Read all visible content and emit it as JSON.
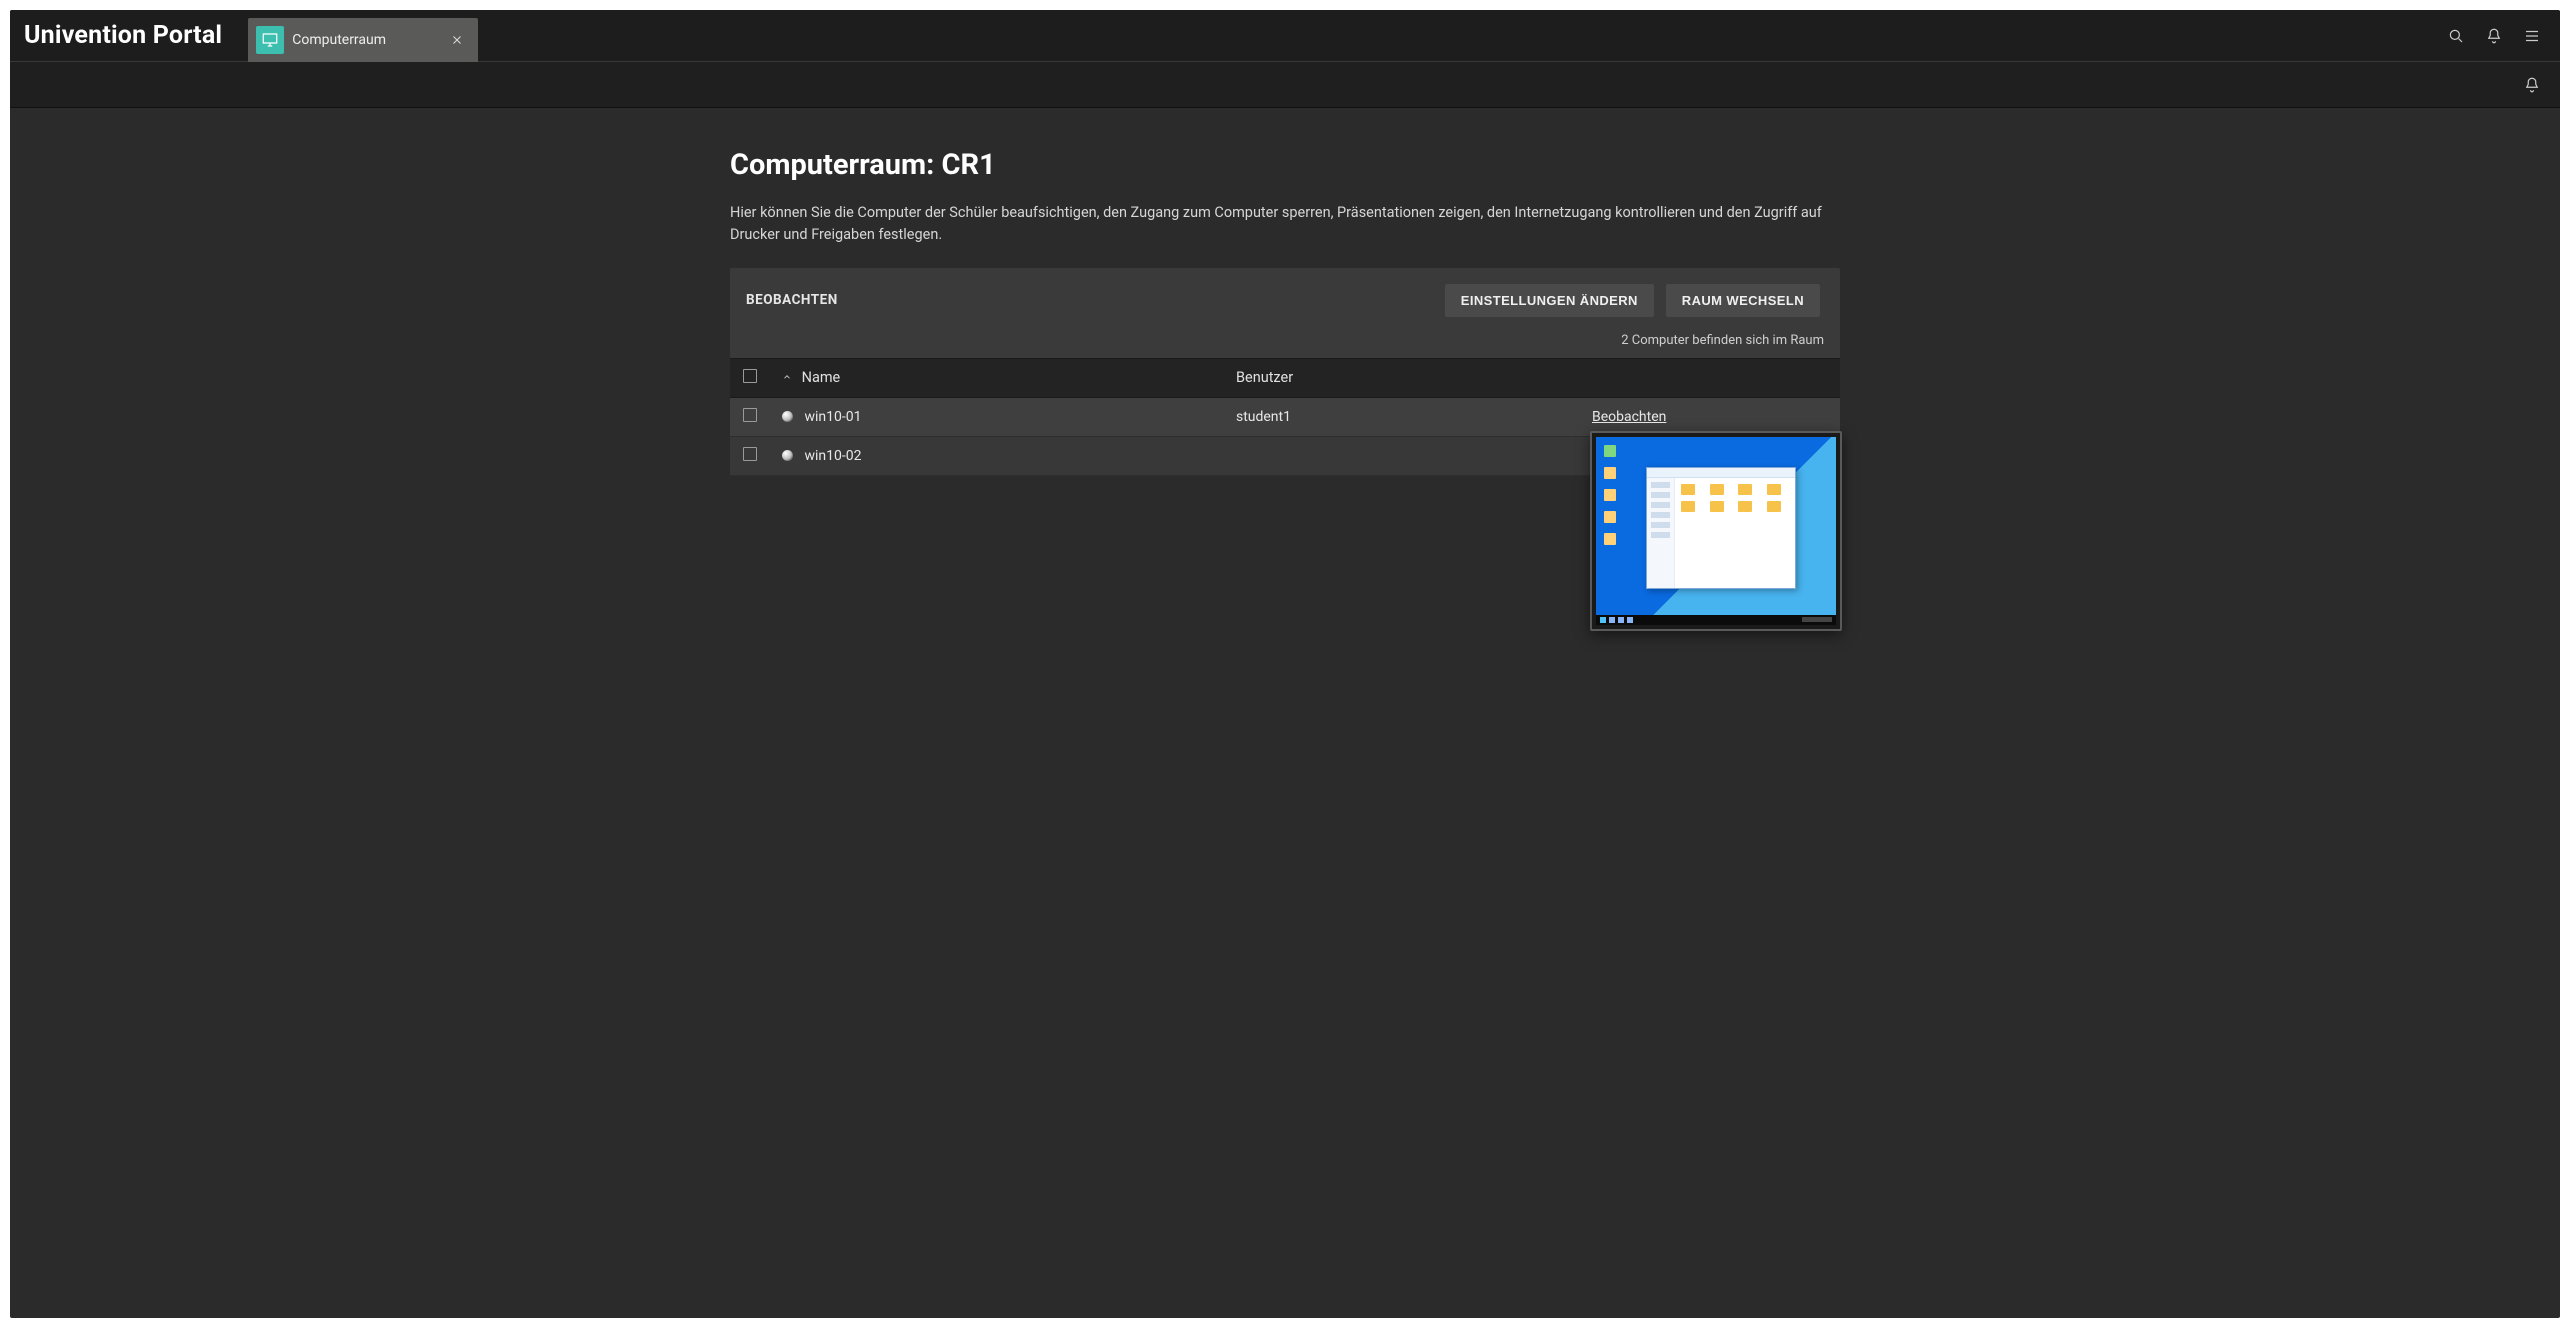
{
  "app": {
    "brand": "Univention Portal"
  },
  "tabs": [
    {
      "label": "Computerraum"
    }
  ],
  "page": {
    "title": "Computerraum: CR1",
    "description": "Hier können Sie die Computer der Schüler beaufsichtigen, den Zugang zum Computer sperren, Präsentationen zeigen, den Internetzugang kontrollieren und den Zugriff auf Drucker und Freigaben festlegen."
  },
  "panel": {
    "title": "BEOBACHTEN",
    "buttons": {
      "settings": "EINSTELLUNGEN ÄNDERN",
      "switch_room": "RAUM WECHSELN"
    },
    "subtext": "2 Computer befinden sich im Raum"
  },
  "table": {
    "columns": {
      "name": "Name",
      "user": "Benutzer"
    },
    "rows": [
      {
        "name": "win10-01",
        "user": "student1",
        "action": "Beobachten"
      },
      {
        "name": "win10-02",
        "user": "",
        "action": ""
      }
    ]
  }
}
